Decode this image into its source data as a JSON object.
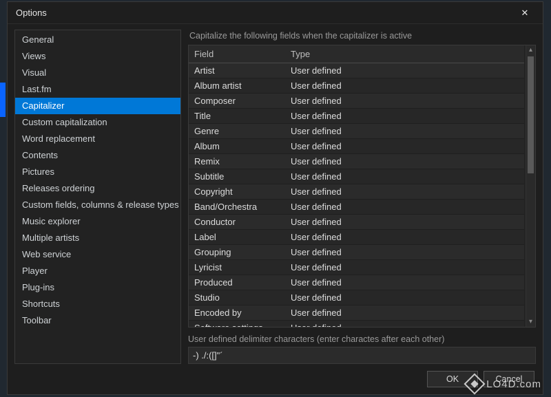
{
  "window": {
    "title": "Options",
    "close_glyph": "✕"
  },
  "sidebar": {
    "items": [
      {
        "label": "General"
      },
      {
        "label": "Views"
      },
      {
        "label": "Visual"
      },
      {
        "label": "Last.fm"
      },
      {
        "label": "Capitalizer",
        "selected": true
      },
      {
        "label": "Custom capitalization"
      },
      {
        "label": "Word replacement"
      },
      {
        "label": "Contents"
      },
      {
        "label": "Pictures"
      },
      {
        "label": "Releases ordering"
      },
      {
        "label": "Custom fields, columns & release types"
      },
      {
        "label": "Music explorer"
      },
      {
        "label": "Multiple artists"
      },
      {
        "label": "Web service"
      },
      {
        "label": "Player"
      },
      {
        "label": "Plug-ins"
      },
      {
        "label": "Shortcuts"
      },
      {
        "label": "Toolbar"
      }
    ]
  },
  "main": {
    "caption": "Capitalize the following fields when the capitalizer is active",
    "columns": {
      "field": "Field",
      "type": "Type"
    },
    "rows": [
      {
        "field": "Artist",
        "type": "User defined"
      },
      {
        "field": "Album artist",
        "type": "User defined"
      },
      {
        "field": "Composer",
        "type": "User defined"
      },
      {
        "field": "Title",
        "type": "User defined"
      },
      {
        "field": "Genre",
        "type": "User defined"
      },
      {
        "field": "Album",
        "type": "User defined"
      },
      {
        "field": "Remix",
        "type": "User defined"
      },
      {
        "field": "Subtitle",
        "type": "User defined"
      },
      {
        "field": "Copyright",
        "type": "User defined"
      },
      {
        "field": "Band/Orchestra",
        "type": "User defined"
      },
      {
        "field": "Conductor",
        "type": "User defined"
      },
      {
        "field": "Label",
        "type": "User defined"
      },
      {
        "field": "Grouping",
        "type": "User defined"
      },
      {
        "field": "Lyricist",
        "type": "User defined"
      },
      {
        "field": "Produced",
        "type": "User defined"
      },
      {
        "field": "Studio",
        "type": "User defined"
      },
      {
        "field": "Encoded by",
        "type": "User defined"
      },
      {
        "field": "Software settings",
        "type": "User defined"
      }
    ],
    "delimiter_label": "User defined delimiter characters (enter charactes after each other)",
    "delimiter_value": "-) ./:([]\"´"
  },
  "footer": {
    "ok": "OK",
    "cancel": "Cancel"
  },
  "watermark": {
    "text": "LO4D.com"
  },
  "scroll": {
    "up": "▴",
    "down": "▾"
  }
}
